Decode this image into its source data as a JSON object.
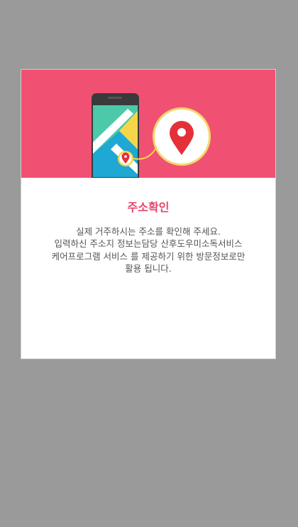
{
  "dialog": {
    "title": "주소확인",
    "message_lines": [
      "실제 거주하시는 주소를 확인해 주세요.",
      "입력하신 주소지 정보는담당 산후도우미소독서비스",
      "케어프로그램 서비스 를 제공하기 위한 방문정보로만",
      "활용 됩니다."
    ]
  },
  "illustration": {
    "icons": [
      "smartphone-map-icon",
      "location-pin-icon"
    ]
  },
  "colors": {
    "backdrop": "#9a9a9a",
    "header_background": "#f05173",
    "title": "#e8456b",
    "body_text": "#555555",
    "pin": "#e5303a",
    "badge_ring": "#f5d96b"
  }
}
